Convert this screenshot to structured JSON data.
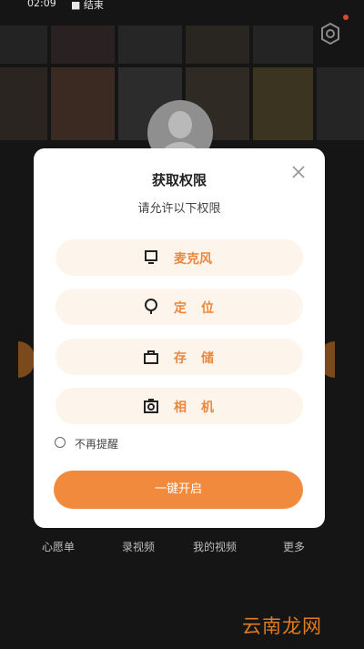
{
  "status_bar": {
    "time": "02:09",
    "recording_label": "结束"
  },
  "background": {
    "bottom_nav": [
      {
        "label": "心愿单"
      },
      {
        "label": "录视频"
      },
      {
        "label": "我的视频"
      },
      {
        "label": "更多"
      }
    ]
  },
  "dialog": {
    "title": "获取权限",
    "subtitle": "请允许以下权限",
    "permissions": [
      {
        "label": "麦克风",
        "icon": "microphone-icon"
      },
      {
        "label": "定位",
        "icon": "location-icon"
      },
      {
        "label": "存储",
        "icon": "storage-icon"
      },
      {
        "label": "相机",
        "icon": "camera-icon"
      }
    ],
    "dont_remind_label": "不再提醒",
    "enable_all_label": "一键开启"
  },
  "watermark": "云南龙网",
  "colors": {
    "accent": "#f18a3c",
    "permission_bg": "#fdf4ec",
    "overlay_bg": "#151515"
  }
}
